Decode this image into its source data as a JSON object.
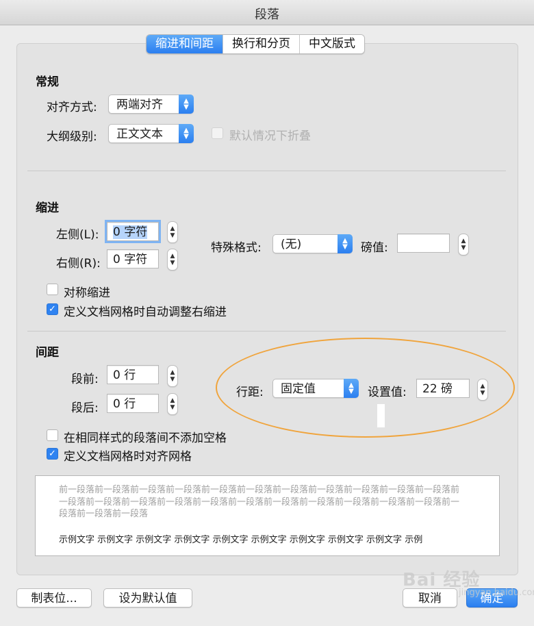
{
  "window": {
    "title": "段落"
  },
  "tabs": [
    {
      "label": "缩进和间距",
      "active": true
    },
    {
      "label": "换行和分页",
      "active": false
    },
    {
      "label": "中文版式",
      "active": false
    }
  ],
  "general": {
    "heading": "常规",
    "alignment_label": "对齐方式:",
    "alignment_value": "两端对齐",
    "outline_label": "大纲级别:",
    "outline_value": "正文文本",
    "collapse_label": "默认情况下折叠",
    "collapse_checked": false,
    "collapse_enabled": false
  },
  "indent": {
    "heading": "缩进",
    "left_label": "左侧(L):",
    "left_value": "0 字符",
    "right_label": "右侧(R):",
    "right_value": "0 字符",
    "special_label": "特殊格式:",
    "special_value": "(无)",
    "by_label": "磅值:",
    "by_value": "",
    "mirror_label": "对称缩进",
    "mirror_checked": false,
    "auto_adjust_label": "定义文档网格时自动调整右缩进",
    "auto_adjust_checked": true
  },
  "spacing": {
    "heading": "间距",
    "before_label": "段前:",
    "before_value": "0 行",
    "after_label": "段后:",
    "after_value": "0 行",
    "line_spacing_label": "行距:",
    "line_spacing_value": "固定值",
    "at_label": "设置值:",
    "at_value": "22 磅",
    "no_space_same_style_label": "在相同样式的段落间不添加空格",
    "no_space_same_style_checked": false,
    "snap_grid_label": "定义文档网格时对齐网格",
    "snap_grid_checked": true
  },
  "preview": {
    "previous_paragraph": "前一段落前一段落前一段落前一段落前一段落前一段落前一段落前一段落前一段落前一段落前一段落前一段落前一段落前一段落前一段落前一段落前一段落前一段落前一段落前一段落前一段落前一段落前一段落前一段落前一段落",
    "sample_text": "示例文字 示例文字 示例文字 示例文字 示例文字 示例文字 示例文字 示例文字 示例文字 示例"
  },
  "buttons": {
    "tabs_label": "制表位...",
    "set_default_label": "设为默认值",
    "cancel_label": "取消",
    "ok_label": "确定"
  },
  "watermark": {
    "text": "Bai 经验",
    "sub": "jingyan.baidu.com"
  },
  "colors": {
    "accent": "#2b7ff0",
    "annotation": "#f0a43c"
  }
}
